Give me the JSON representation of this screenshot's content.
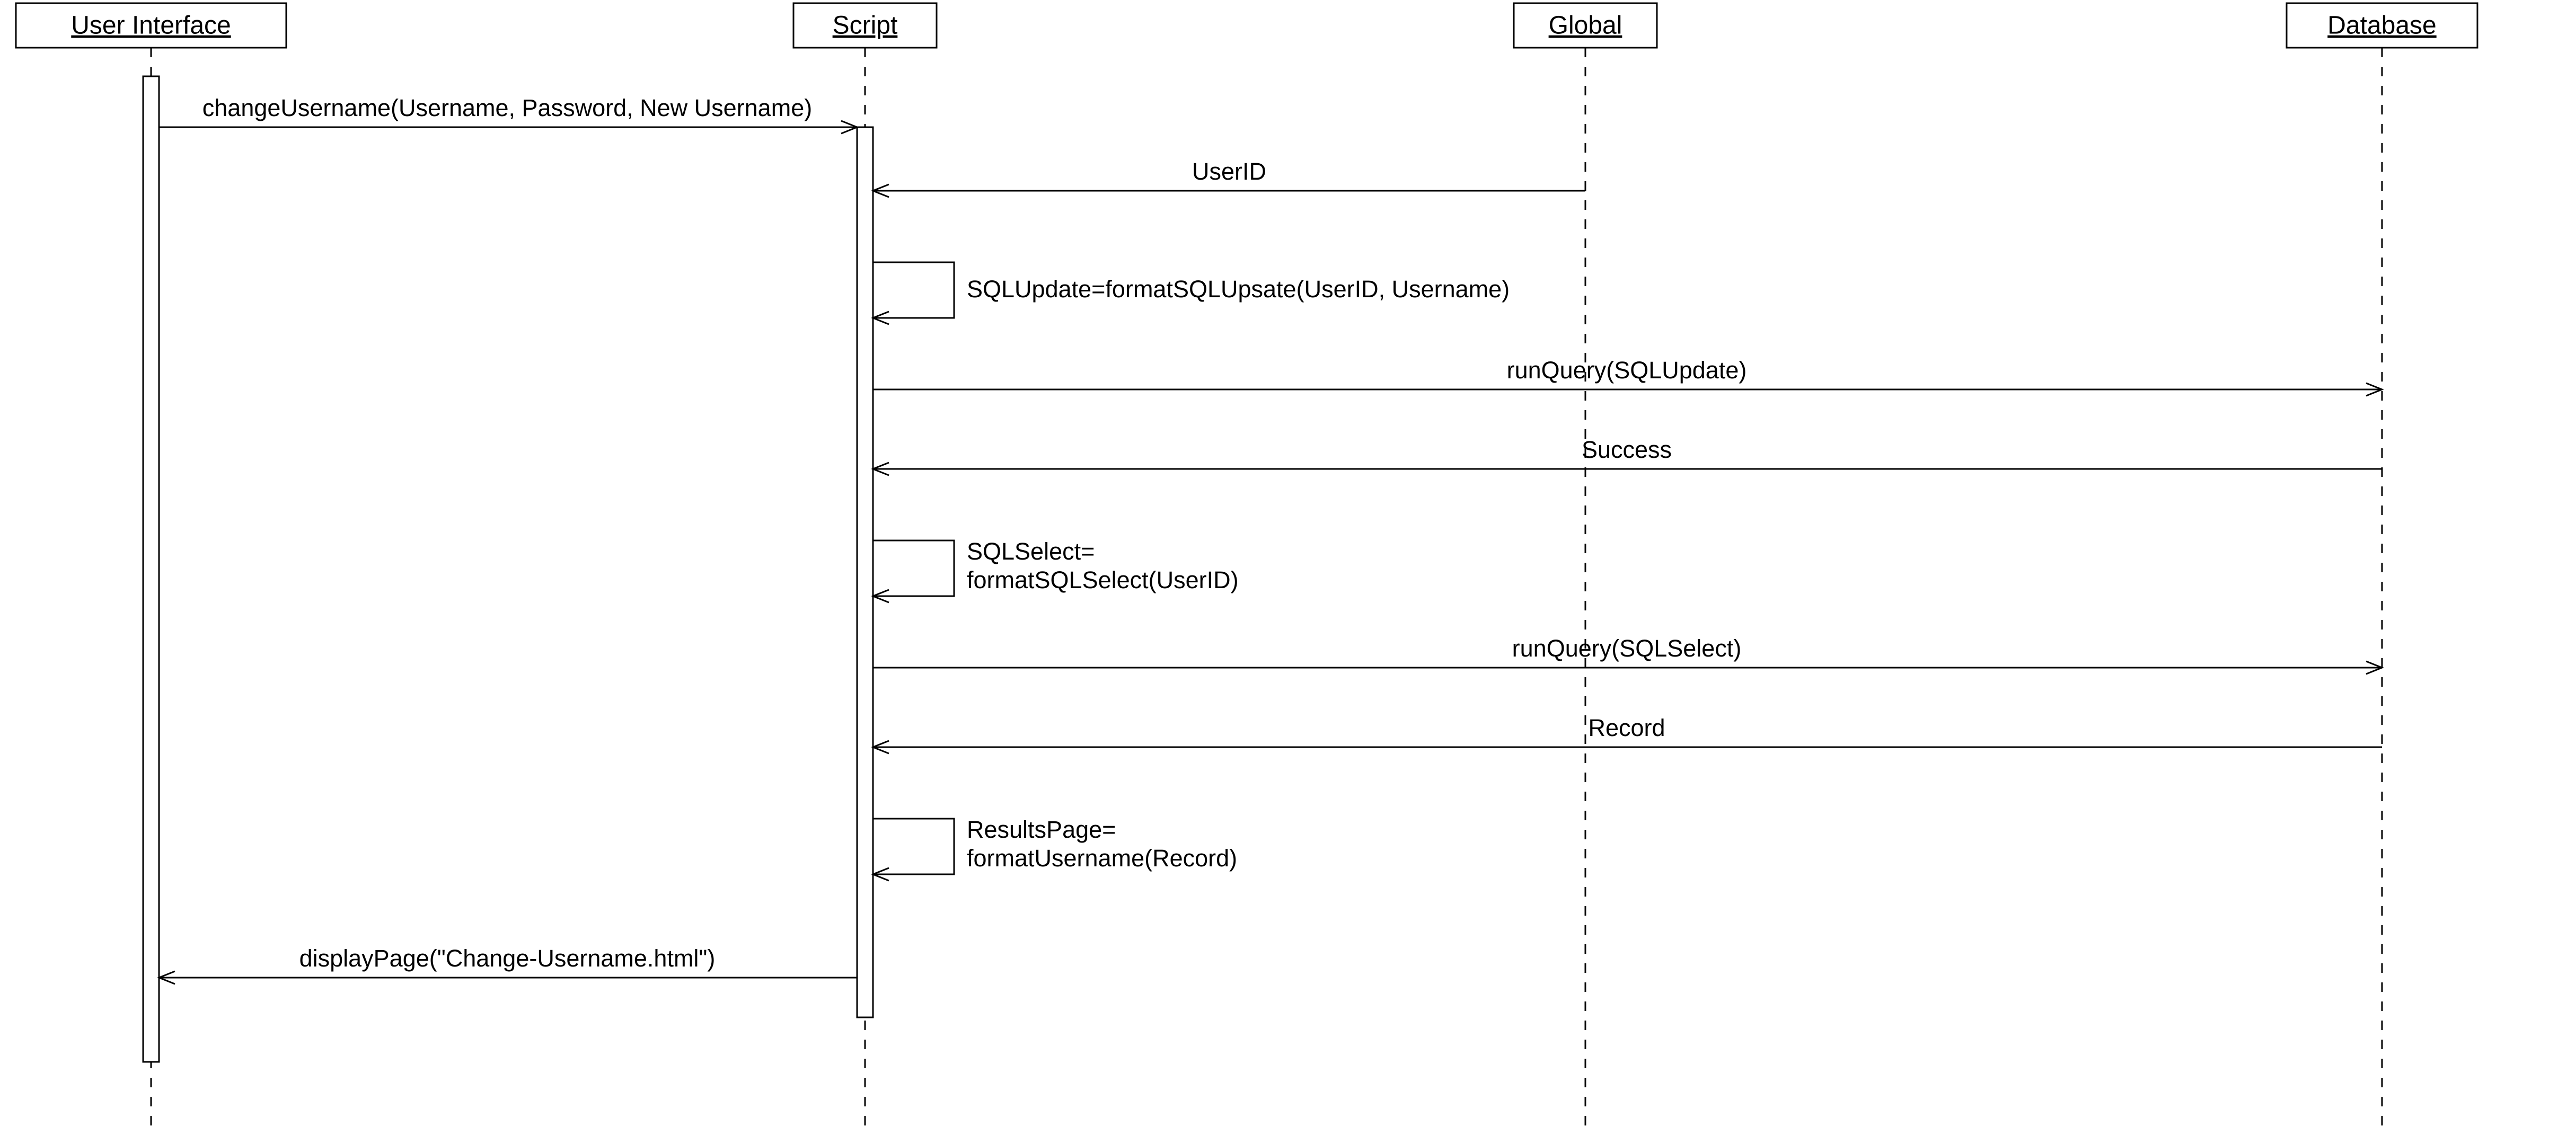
{
  "lifelines": {
    "ui": "User Interface",
    "script": "Script",
    "global": "Global",
    "database": "Database"
  },
  "messages": {
    "m1": "changeUsername(Username, Password, New Username)",
    "m2": "UserID",
    "m3": "SQLUpdate=formatSQLUpsate(UserID, Username)",
    "m4": "runQuery(SQLUpdate)",
    "m5": "Success",
    "m6a": "SQLSelect=",
    "m6b": "formatSQLSelect(UserID)",
    "m7": "runQuery(SQLSelect)",
    "m8": "Record",
    "m9a": "ResultsPage=",
    "m9b": "formatUsername(Record)",
    "m10": "displayPage(\"Change-Username.html\")"
  }
}
